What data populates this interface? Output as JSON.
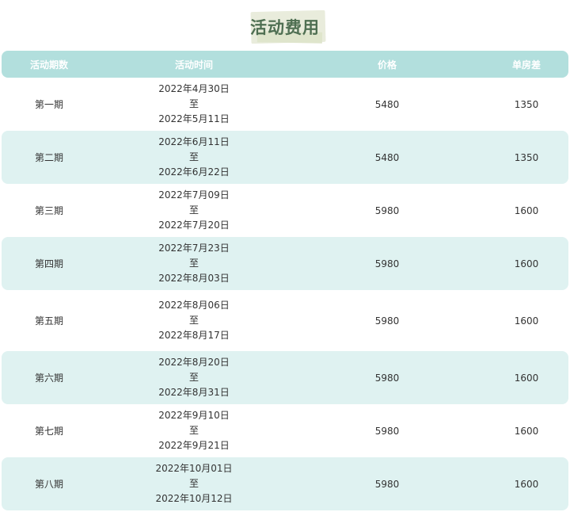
{
  "title": "活动费用",
  "colors": {
    "header_bg": "#b2dfdd",
    "alt_row_bg": "#dff2f1",
    "title_color": "#4f6f52",
    "title_highlight": "#e9ecdc"
  },
  "table": {
    "headers": {
      "period": "活动期数",
      "time": "活动时间",
      "price": "价格",
      "single": "单房差"
    },
    "rows": [
      {
        "period": "第一期",
        "start": "2022年4月30日",
        "sep": "至",
        "end": "2022年5月11日",
        "price": "5480",
        "single": "1350"
      },
      {
        "period": "第二期",
        "start": "2022年6月11日",
        "sep": "至",
        "end": "2022年6月22日",
        "price": "5480",
        "single": "1350"
      },
      {
        "period": "第三期",
        "start": "2022年7月09日",
        "sep": "至",
        "end": "2022年7月20日",
        "price": "5980",
        "single": "1600"
      },
      {
        "period": "第四期",
        "start": "2022年7月23日",
        "sep": "至",
        "end": "2022年8月03日",
        "price": "5980",
        "single": "1600"
      },
      {
        "period": "第五期",
        "start": "2022年8月06日",
        "sep": "至",
        "end": "2022年8月17日",
        "price": "5980",
        "single": "1600"
      },
      {
        "period": "第六期",
        "start": "2022年8月20日",
        "sep": "至",
        "end": "2022年8月31日",
        "price": "5980",
        "single": "1600"
      },
      {
        "period": "第七期",
        "start": "2022年9月10日",
        "sep": "至",
        "end": "2022年9月21日",
        "price": "5980",
        "single": "1600"
      },
      {
        "period": "第八期",
        "start": "2022年10月01日",
        "sep": "至",
        "end": "2022年10月12日",
        "price": "5980",
        "single": "1600"
      }
    ]
  }
}
